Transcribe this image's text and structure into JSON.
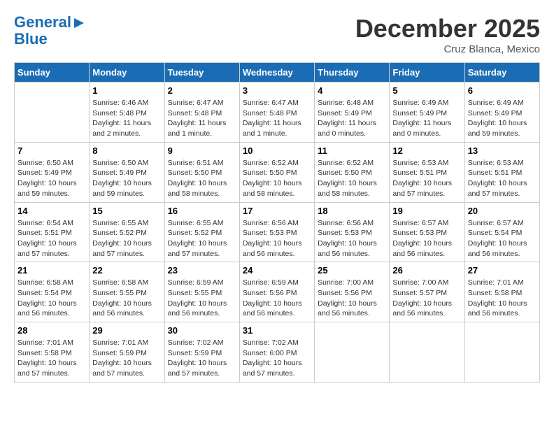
{
  "logo": {
    "line1": "General",
    "line2": "Blue"
  },
  "title": "December 2025",
  "location": "Cruz Blanca, Mexico",
  "days_of_week": [
    "Sunday",
    "Monday",
    "Tuesday",
    "Wednesday",
    "Thursday",
    "Friday",
    "Saturday"
  ],
  "weeks": [
    [
      {
        "day": "",
        "info": ""
      },
      {
        "day": "1",
        "info": "Sunrise: 6:46 AM\nSunset: 5:48 PM\nDaylight: 11 hours\nand 2 minutes."
      },
      {
        "day": "2",
        "info": "Sunrise: 6:47 AM\nSunset: 5:48 PM\nDaylight: 11 hours\nand 1 minute."
      },
      {
        "day": "3",
        "info": "Sunrise: 6:47 AM\nSunset: 5:48 PM\nDaylight: 11 hours\nand 1 minute."
      },
      {
        "day": "4",
        "info": "Sunrise: 6:48 AM\nSunset: 5:49 PM\nDaylight: 11 hours\nand 0 minutes."
      },
      {
        "day": "5",
        "info": "Sunrise: 6:49 AM\nSunset: 5:49 PM\nDaylight: 11 hours\nand 0 minutes."
      },
      {
        "day": "6",
        "info": "Sunrise: 6:49 AM\nSunset: 5:49 PM\nDaylight: 10 hours\nand 59 minutes."
      }
    ],
    [
      {
        "day": "7",
        "info": "Sunrise: 6:50 AM\nSunset: 5:49 PM\nDaylight: 10 hours\nand 59 minutes."
      },
      {
        "day": "8",
        "info": "Sunrise: 6:50 AM\nSunset: 5:49 PM\nDaylight: 10 hours\nand 59 minutes."
      },
      {
        "day": "9",
        "info": "Sunrise: 6:51 AM\nSunset: 5:50 PM\nDaylight: 10 hours\nand 58 minutes."
      },
      {
        "day": "10",
        "info": "Sunrise: 6:52 AM\nSunset: 5:50 PM\nDaylight: 10 hours\nand 58 minutes."
      },
      {
        "day": "11",
        "info": "Sunrise: 6:52 AM\nSunset: 5:50 PM\nDaylight: 10 hours\nand 58 minutes."
      },
      {
        "day": "12",
        "info": "Sunrise: 6:53 AM\nSunset: 5:51 PM\nDaylight: 10 hours\nand 57 minutes."
      },
      {
        "day": "13",
        "info": "Sunrise: 6:53 AM\nSunset: 5:51 PM\nDaylight: 10 hours\nand 57 minutes."
      }
    ],
    [
      {
        "day": "14",
        "info": "Sunrise: 6:54 AM\nSunset: 5:51 PM\nDaylight: 10 hours\nand 57 minutes."
      },
      {
        "day": "15",
        "info": "Sunrise: 6:55 AM\nSunset: 5:52 PM\nDaylight: 10 hours\nand 57 minutes."
      },
      {
        "day": "16",
        "info": "Sunrise: 6:55 AM\nSunset: 5:52 PM\nDaylight: 10 hours\nand 57 minutes."
      },
      {
        "day": "17",
        "info": "Sunrise: 6:56 AM\nSunset: 5:53 PM\nDaylight: 10 hours\nand 56 minutes."
      },
      {
        "day": "18",
        "info": "Sunrise: 6:56 AM\nSunset: 5:53 PM\nDaylight: 10 hours\nand 56 minutes."
      },
      {
        "day": "19",
        "info": "Sunrise: 6:57 AM\nSunset: 5:53 PM\nDaylight: 10 hours\nand 56 minutes."
      },
      {
        "day": "20",
        "info": "Sunrise: 6:57 AM\nSunset: 5:54 PM\nDaylight: 10 hours\nand 56 minutes."
      }
    ],
    [
      {
        "day": "21",
        "info": "Sunrise: 6:58 AM\nSunset: 5:54 PM\nDaylight: 10 hours\nand 56 minutes."
      },
      {
        "day": "22",
        "info": "Sunrise: 6:58 AM\nSunset: 5:55 PM\nDaylight: 10 hours\nand 56 minutes."
      },
      {
        "day": "23",
        "info": "Sunrise: 6:59 AM\nSunset: 5:55 PM\nDaylight: 10 hours\nand 56 minutes."
      },
      {
        "day": "24",
        "info": "Sunrise: 6:59 AM\nSunset: 5:56 PM\nDaylight: 10 hours\nand 56 minutes."
      },
      {
        "day": "25",
        "info": "Sunrise: 7:00 AM\nSunset: 5:56 PM\nDaylight: 10 hours\nand 56 minutes."
      },
      {
        "day": "26",
        "info": "Sunrise: 7:00 AM\nSunset: 5:57 PM\nDaylight: 10 hours\nand 56 minutes."
      },
      {
        "day": "27",
        "info": "Sunrise: 7:01 AM\nSunset: 5:58 PM\nDaylight: 10 hours\nand 56 minutes."
      }
    ],
    [
      {
        "day": "28",
        "info": "Sunrise: 7:01 AM\nSunset: 5:58 PM\nDaylight: 10 hours\nand 57 minutes."
      },
      {
        "day": "29",
        "info": "Sunrise: 7:01 AM\nSunset: 5:59 PM\nDaylight: 10 hours\nand 57 minutes."
      },
      {
        "day": "30",
        "info": "Sunrise: 7:02 AM\nSunset: 5:59 PM\nDaylight: 10 hours\nand 57 minutes."
      },
      {
        "day": "31",
        "info": "Sunrise: 7:02 AM\nSunset: 6:00 PM\nDaylight: 10 hours\nand 57 minutes."
      },
      {
        "day": "",
        "info": ""
      },
      {
        "day": "",
        "info": ""
      },
      {
        "day": "",
        "info": ""
      }
    ]
  ]
}
